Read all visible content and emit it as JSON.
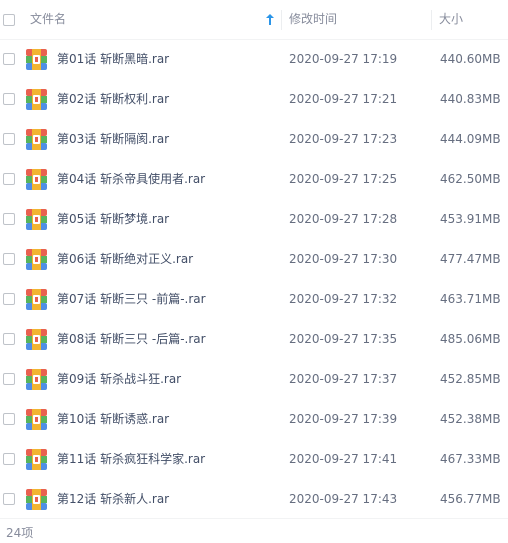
{
  "header": {
    "name_label": "文件名",
    "modified_label": "修改时间",
    "size_label": "大小"
  },
  "files": [
    {
      "name": "第01话 斩断黑暗.rar",
      "modified": "2020-09-27 17:19",
      "size": "440.60MB"
    },
    {
      "name": "第02话 斩断权利.rar",
      "modified": "2020-09-27 17:21",
      "size": "440.83MB"
    },
    {
      "name": "第03话 斩断隔阂.rar",
      "modified": "2020-09-27 17:23",
      "size": "444.09MB"
    },
    {
      "name": "第04话 斩杀帝具使用者.rar",
      "modified": "2020-09-27 17:25",
      "size": "462.50MB"
    },
    {
      "name": "第05话 斩断梦境.rar",
      "modified": "2020-09-27 17:28",
      "size": "453.91MB"
    },
    {
      "name": "第06话 斩断绝对正义.rar",
      "modified": "2020-09-27 17:30",
      "size": "477.47MB"
    },
    {
      "name": "第07话 斩断三只 -前篇-.rar",
      "modified": "2020-09-27 17:32",
      "size": "463.71MB"
    },
    {
      "name": "第08话 斩断三只 -后篇-.rar",
      "modified": "2020-09-27 17:35",
      "size": "485.06MB"
    },
    {
      "name": "第09话 斩杀战斗狂.rar",
      "modified": "2020-09-27 17:37",
      "size": "452.85MB"
    },
    {
      "name": "第10话 斩断诱惑.rar",
      "modified": "2020-09-27 17:39",
      "size": "452.38MB"
    },
    {
      "name": "第11话 斩杀疯狂科学家.rar",
      "modified": "2020-09-27 17:41",
      "size": "467.33MB"
    },
    {
      "name": "第12话 斩杀新人.rar",
      "modified": "2020-09-27 17:43",
      "size": "456.77MB"
    }
  ],
  "footer": {
    "count": "24项"
  },
  "icons": {
    "file": "rar-archive-icon",
    "sort": "sort-ascending-arrow-icon"
  },
  "colors": {
    "sort_arrow": "#2b95e8"
  }
}
